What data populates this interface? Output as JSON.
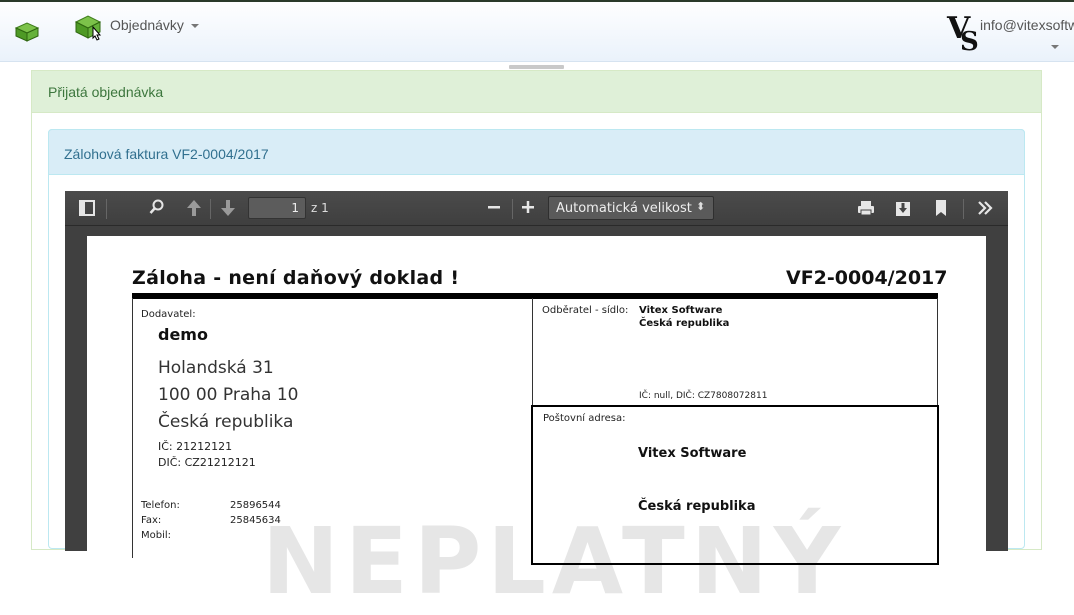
{
  "navbar": {
    "orders_label": "Objednávky",
    "user_label": "info@vitexsoftware",
    "logo_text": "VS"
  },
  "outer_panel": {
    "title": "Přijatá objednávka"
  },
  "inner_panel": {
    "title": "Zálohová faktura VF2-0004/2017"
  },
  "pdf_toolbar": {
    "page_number": "1",
    "page_of": "z 1",
    "zoom_label": "Automatická velikost",
    "zoom_arrows": "⬍"
  },
  "invoice": {
    "title": "Záloha - není daňový doklad !",
    "number": "VF2-0004/2017",
    "supplier_label": "Dodavatel:",
    "supplier_name": "demo",
    "supplier_street": "Holandská 31",
    "supplier_city": "100 00  Praha 10",
    "supplier_country": "Česká republika",
    "supplier_ic": "IČ: 21212121",
    "supplier_dic": "DIČ: CZ21212121",
    "phone_label": "Telefon:",
    "phone_value": "25896544",
    "fax_label": "Fax:",
    "fax_value": "25845634",
    "mobile_label": "Mobil:",
    "customer_label": "Odběratel - sídlo:",
    "customer_name": "Vitex Software",
    "customer_country": "Česká republika",
    "customer_ids": "IČ: null, DIČ: CZ7808072811",
    "postal_label": "Poštovní adresa:",
    "postal_name": "Vitex Software",
    "postal_country": "Česká republika",
    "watermark": "NEPLATNÝ"
  },
  "colors": {
    "success_bg": "#dff0d8",
    "info_bg": "#d9edf7",
    "viewer_bg": "#404040"
  }
}
